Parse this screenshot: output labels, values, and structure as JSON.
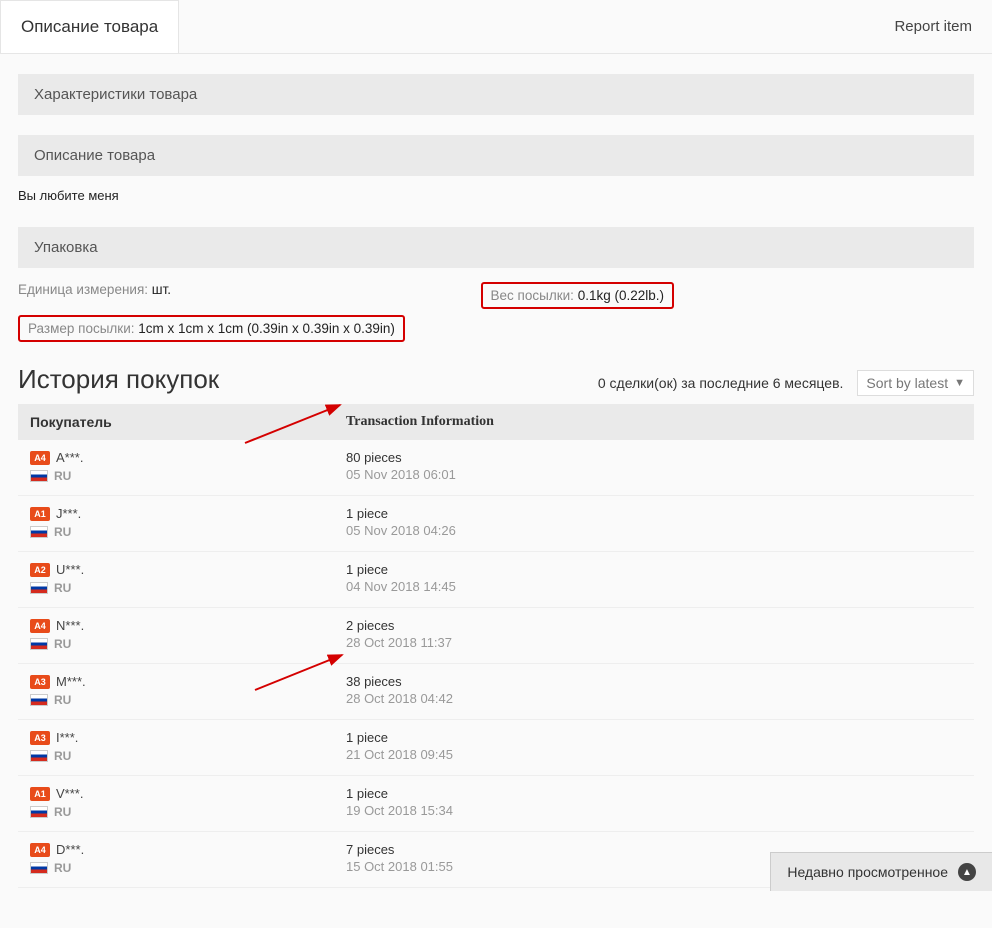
{
  "tabs": {
    "active": "Описание товара",
    "report": "Report item"
  },
  "sections": {
    "specs": "Характеристики товара",
    "desc": "Описание товара",
    "desc_body": "Вы любите меня",
    "packaging": "Упаковка"
  },
  "packaging": {
    "unit_label": "Единица измерения:",
    "unit_value": "шт.",
    "weight_label": "Вес посылки:",
    "weight_value": "0.1kg (0.22lb.)",
    "size_label": "Размер посылки:",
    "size_value": "1cm x 1cm x 1cm (0.39in x 0.39in x 0.39in)"
  },
  "history": {
    "title": "История покупок",
    "deals_text": "0 сделки(ок) за последние 6 месяцев.",
    "sort_label": "Sort by latest",
    "col_buyer": "Покупатель",
    "col_trans": "Transaction Information"
  },
  "transactions": [
    {
      "level": "A4",
      "name": "A***.",
      "country": "RU",
      "pieces": "80 pieces",
      "date": "05 Nov 2018 06:01"
    },
    {
      "level": "A1",
      "name": "J***.",
      "country": "RU",
      "pieces": "1 piece",
      "date": "05 Nov 2018 04:26"
    },
    {
      "level": "A2",
      "name": "U***.",
      "country": "RU",
      "pieces": "1 piece",
      "date": "04 Nov 2018 14:45"
    },
    {
      "level": "A4",
      "name": "N***.",
      "country": "RU",
      "pieces": "2 pieces",
      "date": "28 Oct 2018 11:37"
    },
    {
      "level": "A3",
      "name": "M***.",
      "country": "RU",
      "pieces": "38 pieces",
      "date": "28 Oct 2018 04:42"
    },
    {
      "level": "A3",
      "name": "I***.",
      "country": "RU",
      "pieces": "1 piece",
      "date": "21 Oct 2018 09:45"
    },
    {
      "level": "A1",
      "name": "V***.",
      "country": "RU",
      "pieces": "1 piece",
      "date": "19 Oct 2018 15:34"
    },
    {
      "level": "A4",
      "name": "D***.",
      "country": "RU",
      "pieces": "7 pieces",
      "date": "15 Oct 2018 01:55"
    }
  ],
  "recent_bar": "Недавно просмотренное"
}
